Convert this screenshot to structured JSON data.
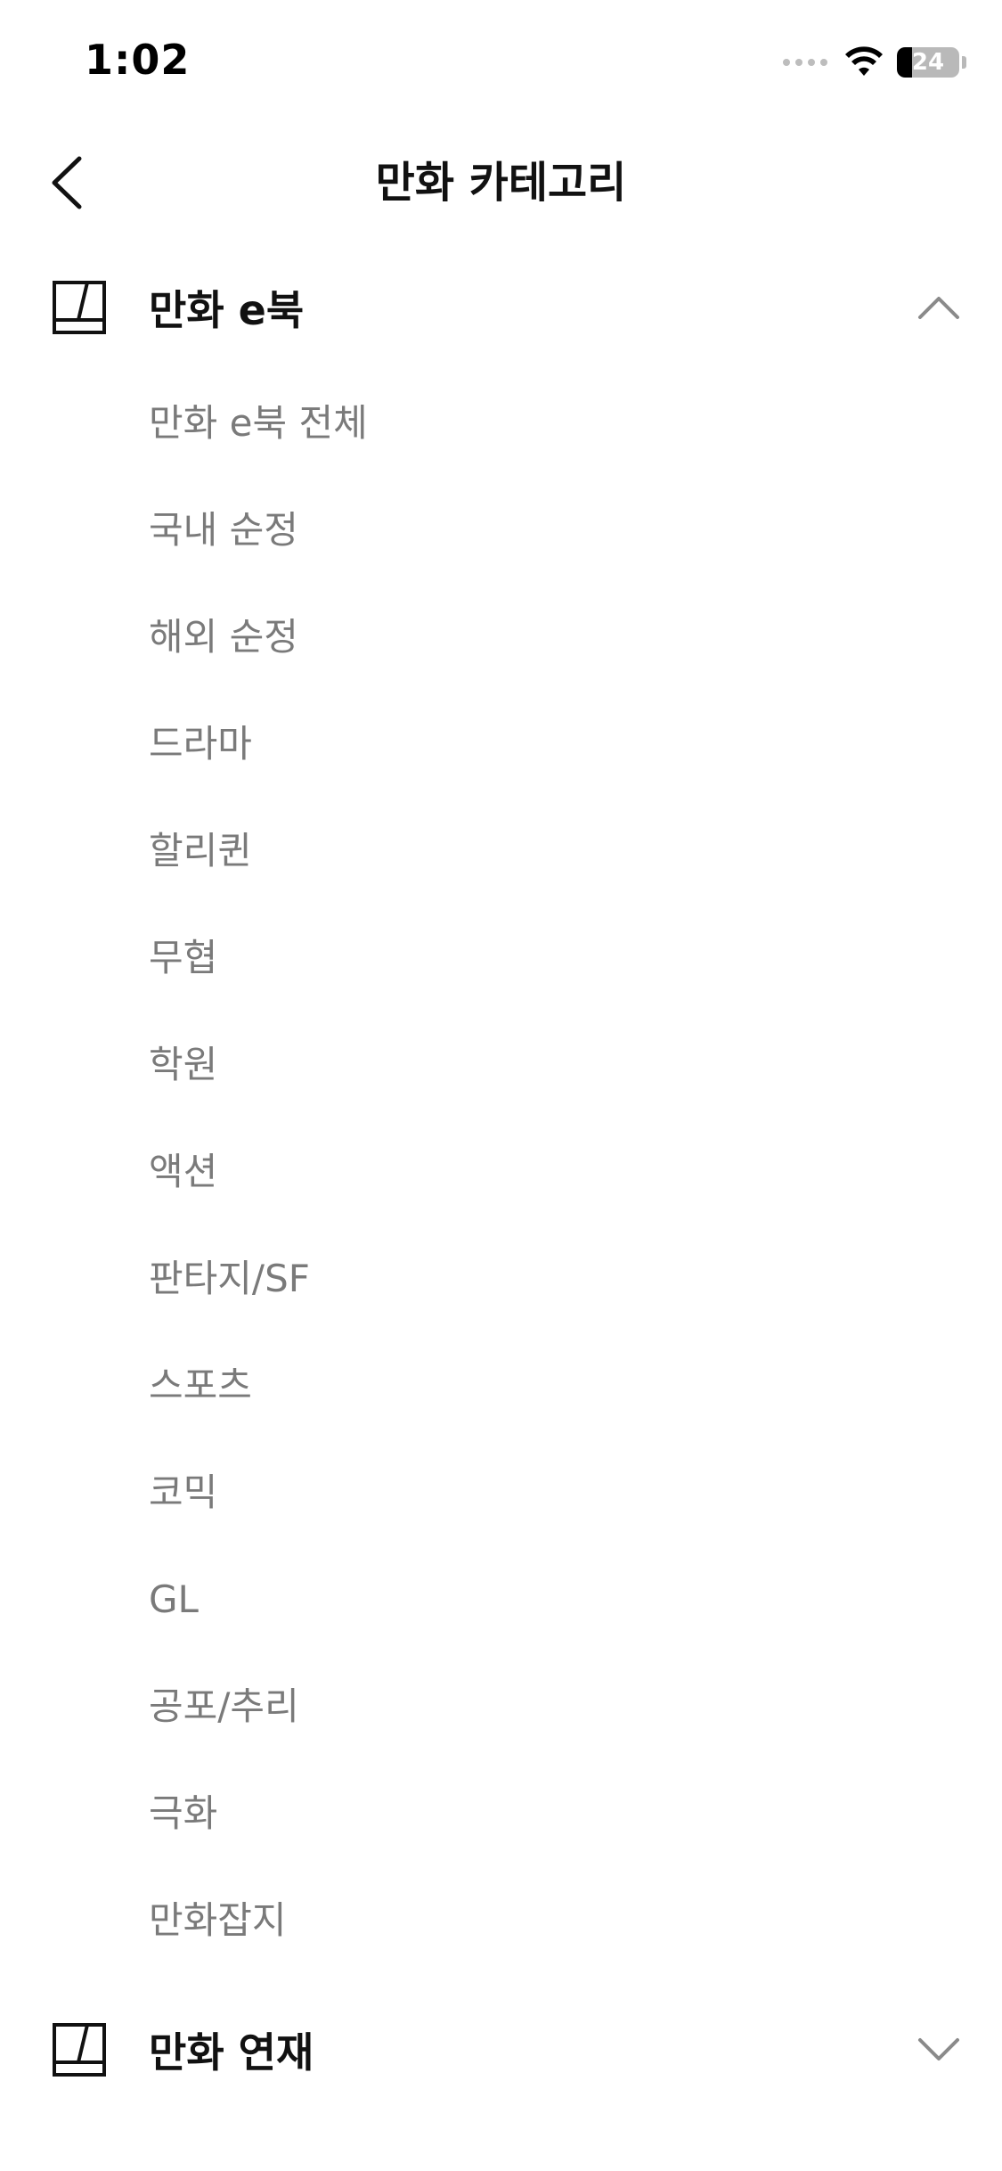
{
  "status_bar": {
    "time": "1:02",
    "battery_level": "24",
    "battery_fraction": 0.24
  },
  "nav": {
    "title": "만화 카테고리",
    "back_icon": "chevron-left-icon"
  },
  "sections": [
    {
      "label": "만화 e북",
      "icon": "book-icon",
      "expanded": true,
      "items": [
        "만화 e북 전체",
        "국내 순정",
        "해외 순정",
        "드라마",
        "할리퀸",
        "무협",
        "학원",
        "액션",
        "판타지/SF",
        "스포츠",
        "코믹",
        "GL",
        "공포/추리",
        "극화",
        "만화잡지"
      ]
    },
    {
      "label": "만화 연재",
      "icon": "book-icon",
      "expanded": false,
      "items": []
    }
  ],
  "colors": {
    "text_primary": "#111111",
    "text_secondary": "#7a7a7a",
    "chevron": "#8a8a8a",
    "background": "#ffffff"
  }
}
